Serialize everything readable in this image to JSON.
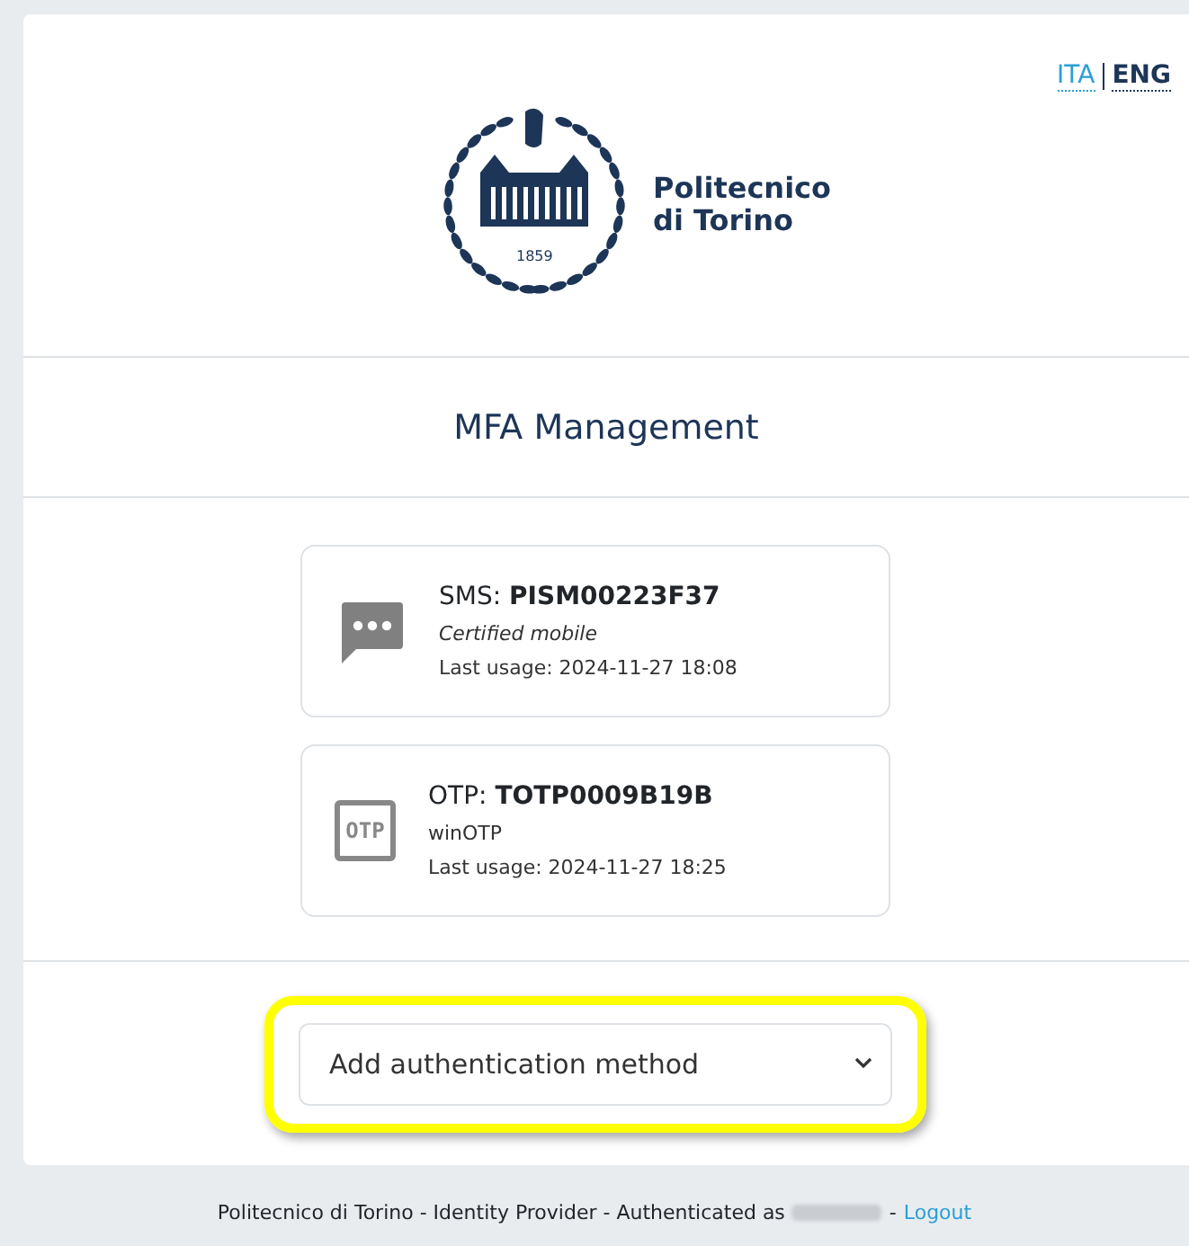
{
  "languages": [
    {
      "label": "ITA",
      "selected": false
    },
    {
      "label": "ENG",
      "selected": true
    }
  ],
  "logo": {
    "year": "1859",
    "name": "Politecnico\ndi Torino"
  },
  "title": "MFA Management",
  "methods": [
    {
      "kind": "sms",
      "type": "SMS:",
      "id": "PISM00223F37",
      "description": "Certified mobile",
      "description_italic": true,
      "last_usage": "Last usage: 2024-11-27 18:08"
    },
    {
      "kind": "otp",
      "type": "OTP:",
      "id": "TOTP0009B19B",
      "description": "winOTP",
      "description_italic": false,
      "last_usage": "Last usage: 2024-11-27 18:25",
      "icon_text": "OTP"
    }
  ],
  "add_method": {
    "value": "Add authentication method",
    "highlighted": true
  },
  "footer": {
    "text": "Politecnico di Torino - Identity Provider - Authenticated as",
    "separator": "-",
    "link": "Logout"
  }
}
